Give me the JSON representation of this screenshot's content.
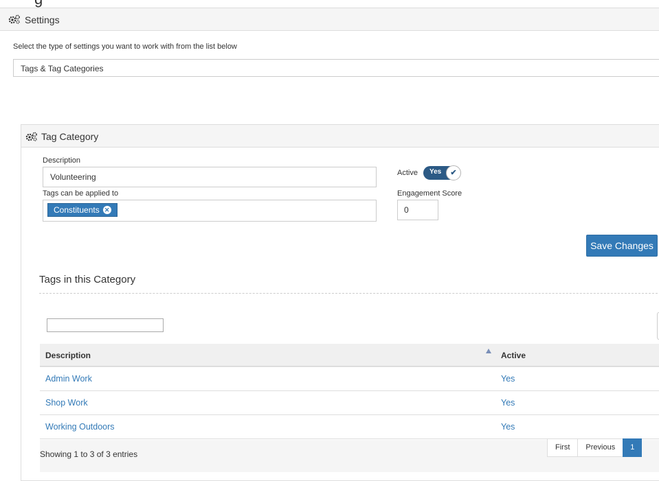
{
  "settings": {
    "heading": "Settings",
    "instruction": "Select the type of settings you want to work with from the list below",
    "selected_type": "Tags & Tag Categories"
  },
  "tag_category": {
    "heading": "Tag Category",
    "description_label": "Description",
    "description_value": "Volunteering",
    "applied_label": "Tags can be applied to",
    "applied_chips": [
      "Constituents"
    ],
    "active_label": "Active",
    "active_toggle": "Yes",
    "engagement_label": "Engagement Score",
    "engagement_value": "0",
    "save_label": "Save Changes"
  },
  "tags_section": {
    "title": "Tags in this Category",
    "filter_value": "",
    "columns": [
      "Description",
      "Active"
    ],
    "rows": [
      {
        "description": "Admin Work",
        "active": "Yes"
      },
      {
        "description": "Shop Work",
        "active": "Yes"
      },
      {
        "description": "Working Outdoors",
        "active": "Yes"
      }
    ],
    "showing": "Showing 1 to 3 of 3 entries",
    "pager": {
      "first": "First",
      "previous": "Previous",
      "current": "1"
    }
  },
  "colors": {
    "accent": "#337ab7",
    "toggle": "#2c5a85",
    "panel_bg": "#f5f5f5",
    "border": "#dddddd"
  },
  "icons": {
    "panel_heading_icon": "gears-icon",
    "chip_remove_icon": "remove-circle-icon",
    "toggle_check_icon": "check-icon",
    "sort_icon": "sort-ascending-icon"
  }
}
